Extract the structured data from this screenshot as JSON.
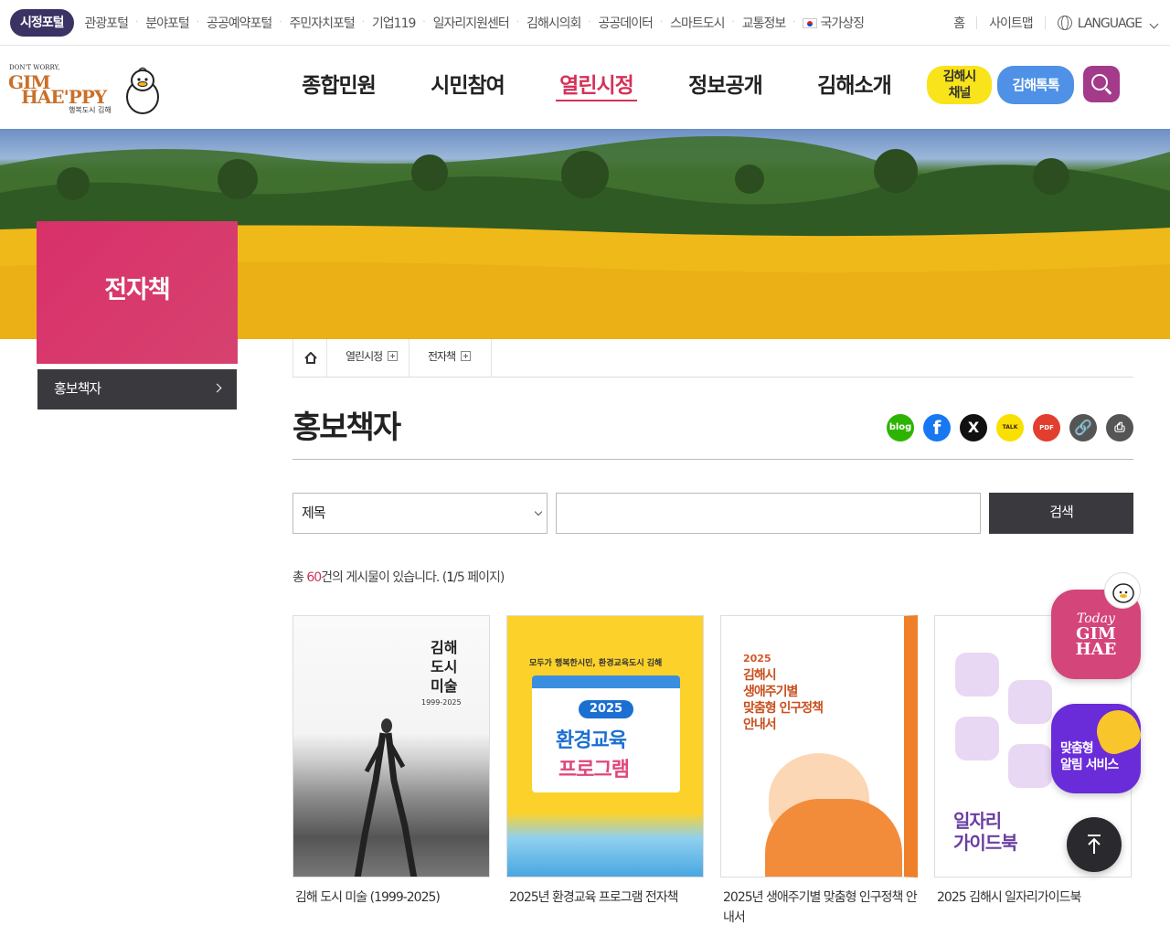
{
  "topbar": {
    "active_portal": "시정포털",
    "portals": [
      "관광포털",
      "분야포털",
      "공공예약포털",
      "주민자치포털",
      "기업119",
      "일자리지원센터",
      "김해시의회",
      "공공데이터",
      "스마트도시",
      "교통정보",
      "국가상징"
    ],
    "home": "홈",
    "sitemap": "사이트맵",
    "language": "LANGUAGE"
  },
  "logo": {
    "small": "DON'T WORRY,",
    "line1": "GIM",
    "line2": "HAE'PPY",
    "tagline": "행복도시 김해"
  },
  "gnb": [
    "종합민원",
    "시민참여",
    "열린시정",
    "정보공개",
    "김해소개"
  ],
  "gnb_active_index": 2,
  "header_buttons": {
    "channel_line1": "김해시",
    "channel_line2": "채널",
    "talk": "김해톡톡"
  },
  "sidebar": {
    "title": "전자책",
    "menu_item": "홍보책자"
  },
  "breadcrumb": [
    "열린시정",
    "전자책"
  ],
  "page_title": "홍보책자",
  "share": {
    "blog": "blog",
    "facebook": "f",
    "x": "X",
    "kakao": "TALK",
    "pdf": "PDF",
    "link": "🔗",
    "print": "⎙"
  },
  "search": {
    "field_selected": "제목",
    "input_value": "",
    "button": "검색"
  },
  "count": {
    "prefix": "총 ",
    "total": "60",
    "middle": "건의 게시물이 있습니다. (",
    "current": "1",
    "suffix": "/5 페이지)"
  },
  "books": [
    {
      "title": "김해 도시 미술 (1999-2025)",
      "cover_title": "김해\n도시\n미술",
      "cover_years": "1999-2025"
    },
    {
      "title": "2025년 환경교육 프로그램 전자책",
      "cover_top": "모두가 행복한시민, 환경교육도시 김해",
      "cover_year": "2025",
      "cover_line1": "환경교육",
      "cover_line2": "프로그램"
    },
    {
      "title": "2025년 생애주기별 맞춤형 인구정책 안내서",
      "cover_year": "2025",
      "cover_title": "김해시\n생애주기별\n맞춤형 인구정책\n안내서"
    },
    {
      "title": "2025 김해시 일자리가이드북",
      "cover_title": "일자리\n가이드북"
    }
  ],
  "floating": {
    "today_a": "Today",
    "today_b1": "GIM",
    "today_b2": "HAE",
    "alarm_line1": "맞춤형",
    "alarm_line2": "알림 서비스"
  },
  "colors": {
    "accent": "#d43258",
    "dark": "#3a3a3e",
    "portal_active": "#3b3363",
    "talk_blue": "#4e91e6",
    "channel_yellow": "#f9e31a",
    "search_purple": "#a33a8a"
  }
}
